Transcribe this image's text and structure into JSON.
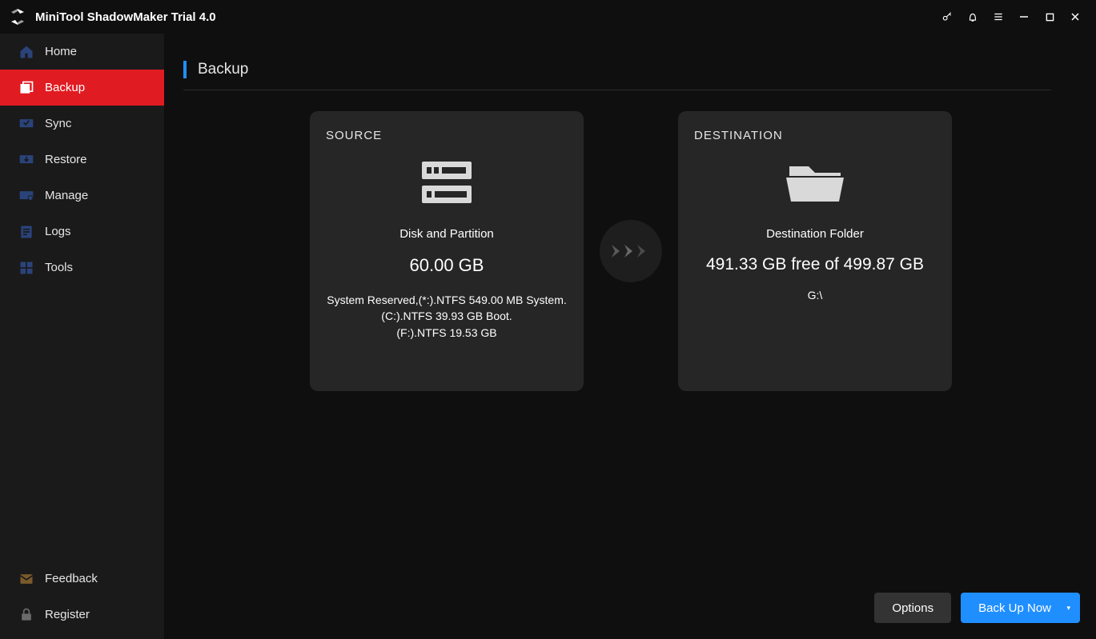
{
  "app_title": "MiniTool ShadowMaker Trial 4.0",
  "page_title": "Backup",
  "sidebar": {
    "items": [
      {
        "label": "Home"
      },
      {
        "label": "Backup"
      },
      {
        "label": "Sync"
      },
      {
        "label": "Restore"
      },
      {
        "label": "Manage"
      },
      {
        "label": "Logs"
      },
      {
        "label": "Tools"
      }
    ],
    "bottom": [
      {
        "label": "Feedback"
      },
      {
        "label": "Register"
      }
    ]
  },
  "source": {
    "title": "SOURCE",
    "label": "Disk and Partition",
    "size": "60.00 GB",
    "detail1": "System Reserved,(*:).NTFS 549.00 MB System.",
    "detail2": "(C:).NTFS 39.93 GB Boot.",
    "detail3": "(F:).NTFS 19.53 GB"
  },
  "destination": {
    "title": "DESTINATION",
    "label": "Destination Folder",
    "free_text": "491.33 GB free of 499.87 GB",
    "path": "G:\\"
  },
  "buttons": {
    "options": "Options",
    "backup_now": "Back Up Now"
  }
}
